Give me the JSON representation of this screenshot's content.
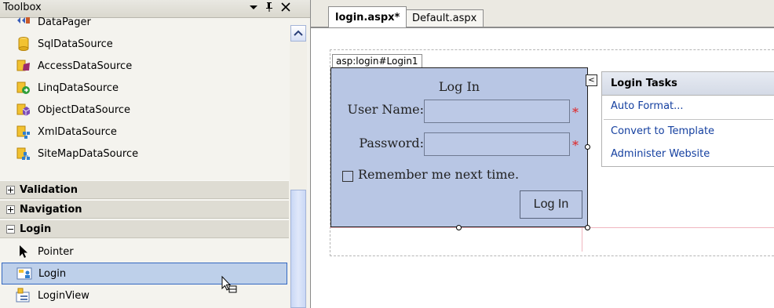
{
  "toolbox": {
    "title": "Toolbox",
    "items_top": [
      {
        "label": "DataPager",
        "icon": "datapager-icon"
      },
      {
        "label": "SqlDataSource",
        "icon": "sqldatasource-icon"
      },
      {
        "label": "AccessDataSource",
        "icon": "accessdatasource-icon"
      },
      {
        "label": "LinqDataSource",
        "icon": "linqdatasource-icon"
      },
      {
        "label": "ObjectDataSource",
        "icon": "objectdatasource-icon"
      },
      {
        "label": "XmlDataSource",
        "icon": "xmldatasource-icon"
      },
      {
        "label": "SiteMapDataSource",
        "icon": "sitemapdatasource-icon"
      }
    ],
    "groups": [
      {
        "label": "Validation",
        "expanded": false
      },
      {
        "label": "Navigation",
        "expanded": false
      },
      {
        "label": "Login",
        "expanded": true
      }
    ],
    "login_items": [
      {
        "label": "Pointer",
        "icon": "pointer-icon"
      },
      {
        "label": "Login",
        "icon": "login-control-icon",
        "selected": true
      },
      {
        "label": "LoginView",
        "icon": "loginview-icon"
      }
    ]
  },
  "editor": {
    "tabs": [
      {
        "label": "login.aspx*",
        "active": true
      },
      {
        "label": "Default.aspx",
        "active": false
      }
    ],
    "control_tag": "asp:login#Login1",
    "login_control": {
      "title": "Log In",
      "username_label": "User Name:",
      "password_label": "Password:",
      "required_marker": "*",
      "remember_label": "Remember me next time.",
      "remember_checked": false,
      "button_label": "Log In"
    },
    "smart_tag_glyph": "<",
    "tasks_panel": {
      "title": "Login Tasks",
      "links": [
        "Auto Format...",
        "Convert to Template",
        "Administer Website"
      ]
    }
  },
  "colors": {
    "login_bg": "#b8c6e4",
    "selection_bg": "#bed0ea",
    "link": "#1540a0",
    "required": "#e02020"
  }
}
